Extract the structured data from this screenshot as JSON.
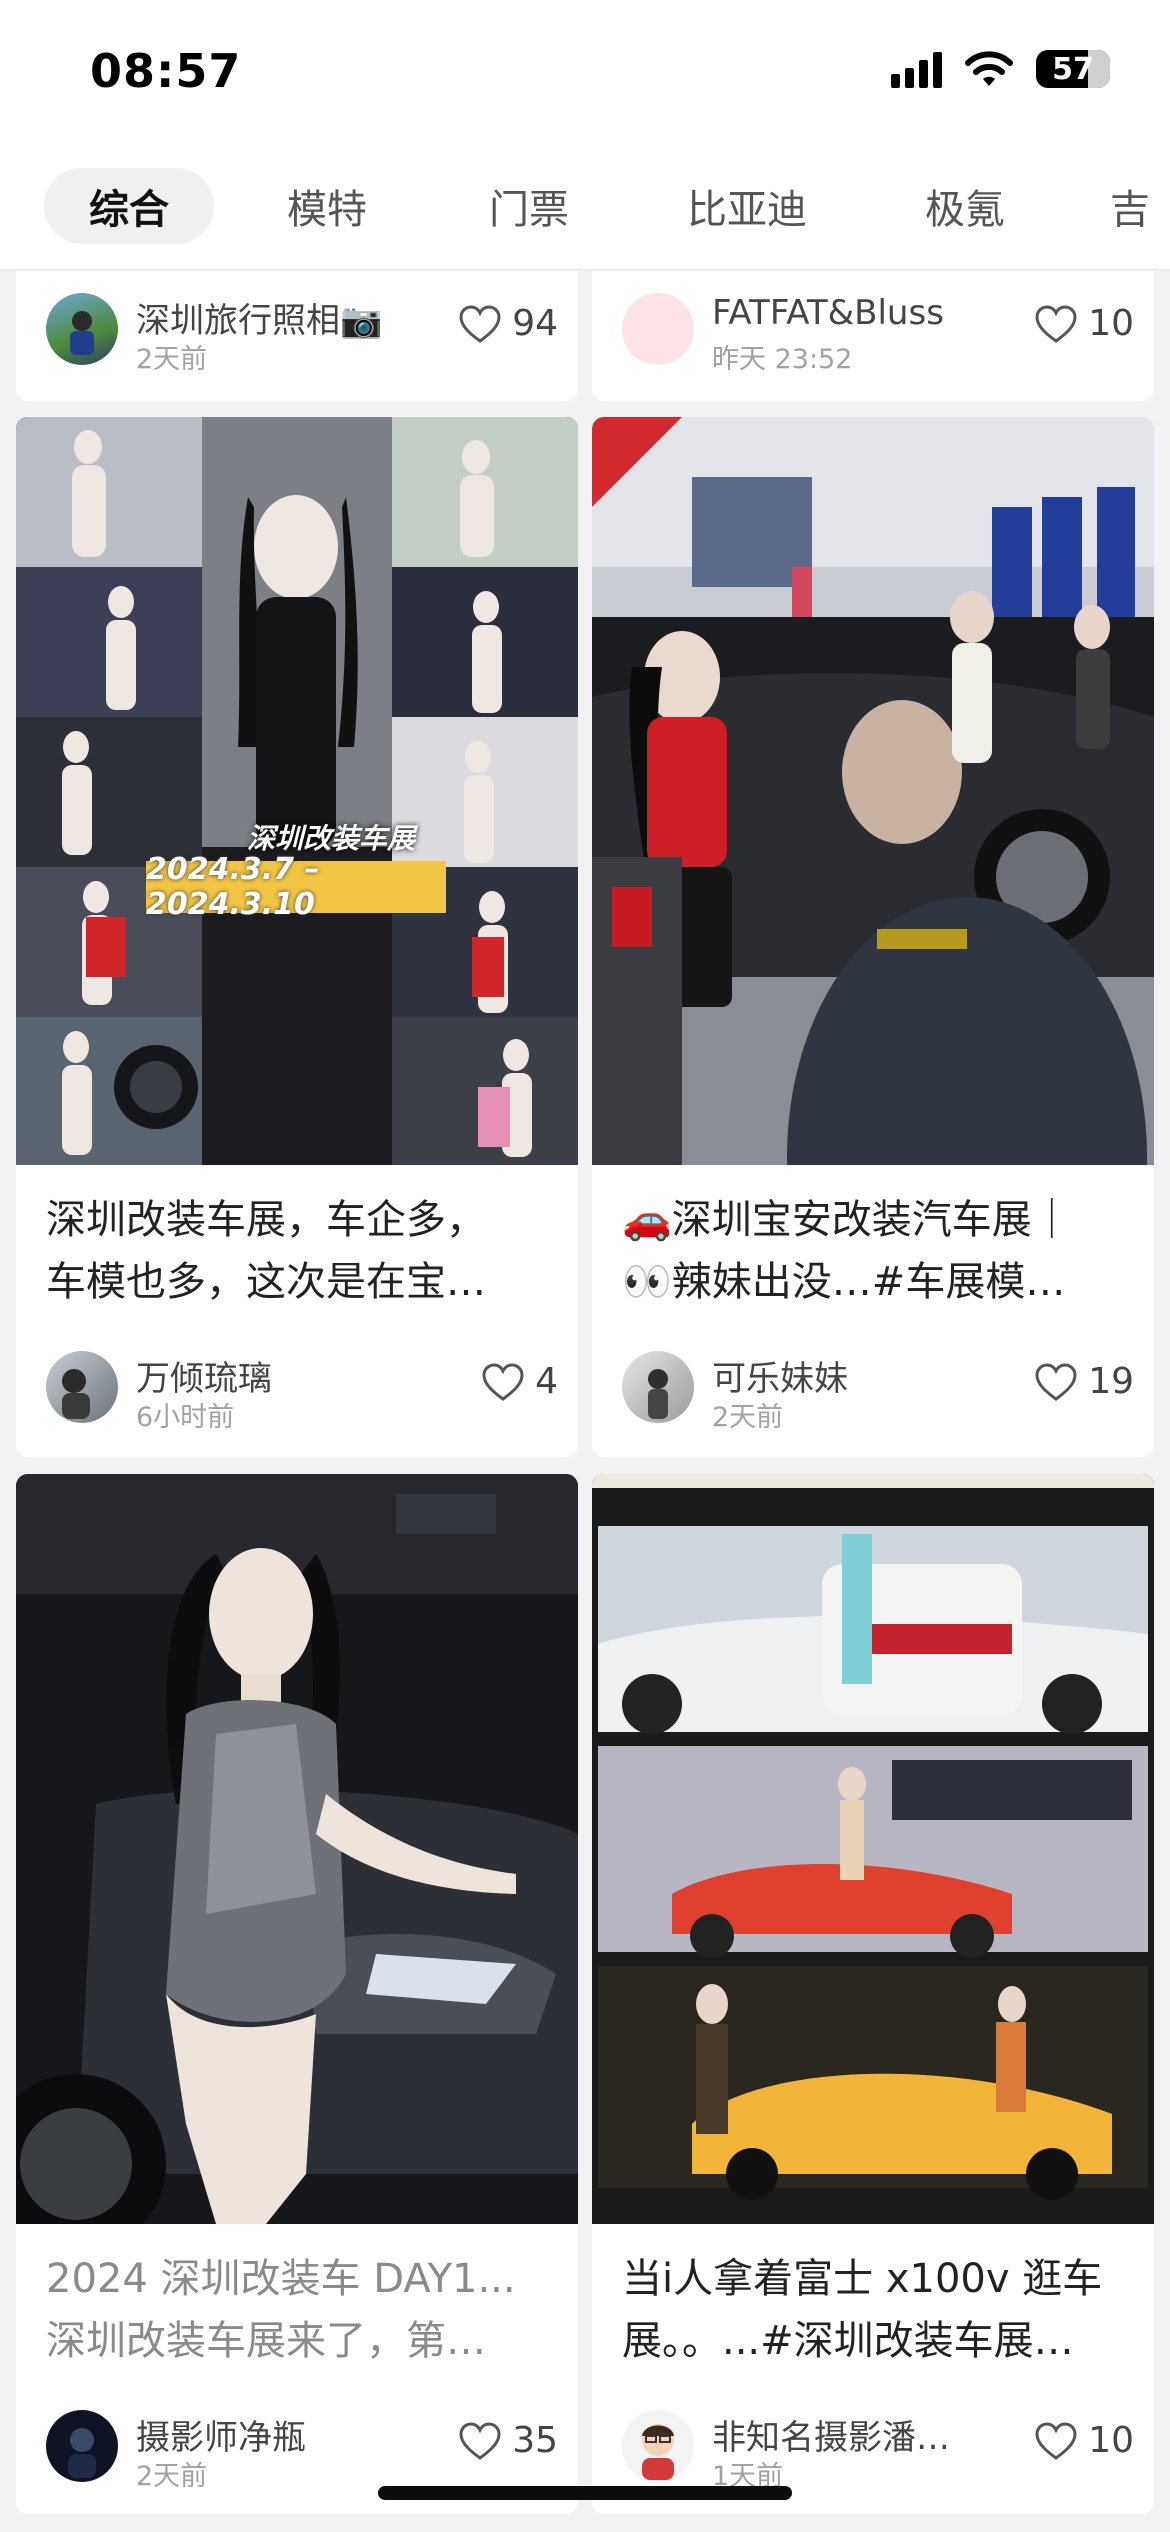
{
  "status": {
    "time": "08:57",
    "battery": "57"
  },
  "tabs": [
    "综合",
    "模特",
    "门票",
    "比亚迪",
    "极氪",
    "吉"
  ],
  "active_tab": 0,
  "top_cards": [
    {
      "author": "深圳旅行照相📷",
      "time": "2天前",
      "likes": "94"
    },
    {
      "author": "FATFAT&Bluss",
      "time": "昨天 23:52",
      "likes": "10"
    }
  ],
  "posts": [
    {
      "image_caption_1": "深圳改装车展",
      "image_caption_2": "2024.3.7 –2024.3.10",
      "title_line1": "深圳改装车展，车企多，",
      "title_line2": "车模也多，这次是在宝…",
      "author": "万倾琉璃",
      "time": "6小时前",
      "likes": "4"
    },
    {
      "title_line1": "🚗深圳宝安改装汽车展｜",
      "title_line2": "👀辣妹出没…#车展模…",
      "author": "可乐妹妹",
      "time": "2天前",
      "likes": "19"
    },
    {
      "title_line1": "2024 深圳改装车 DAY1...",
      "title_line2": "深圳改装车展来了，第…",
      "author": "摄影师净瓶",
      "time": "2天前",
      "likes": "35"
    },
    {
      "title_line1": "当i人拿着富士 x100v 逛车",
      "title_line2": "展。。...#深圳改装车展…",
      "author": "非知名摄影潘…",
      "time": "1天前",
      "likes": "10"
    }
  ]
}
